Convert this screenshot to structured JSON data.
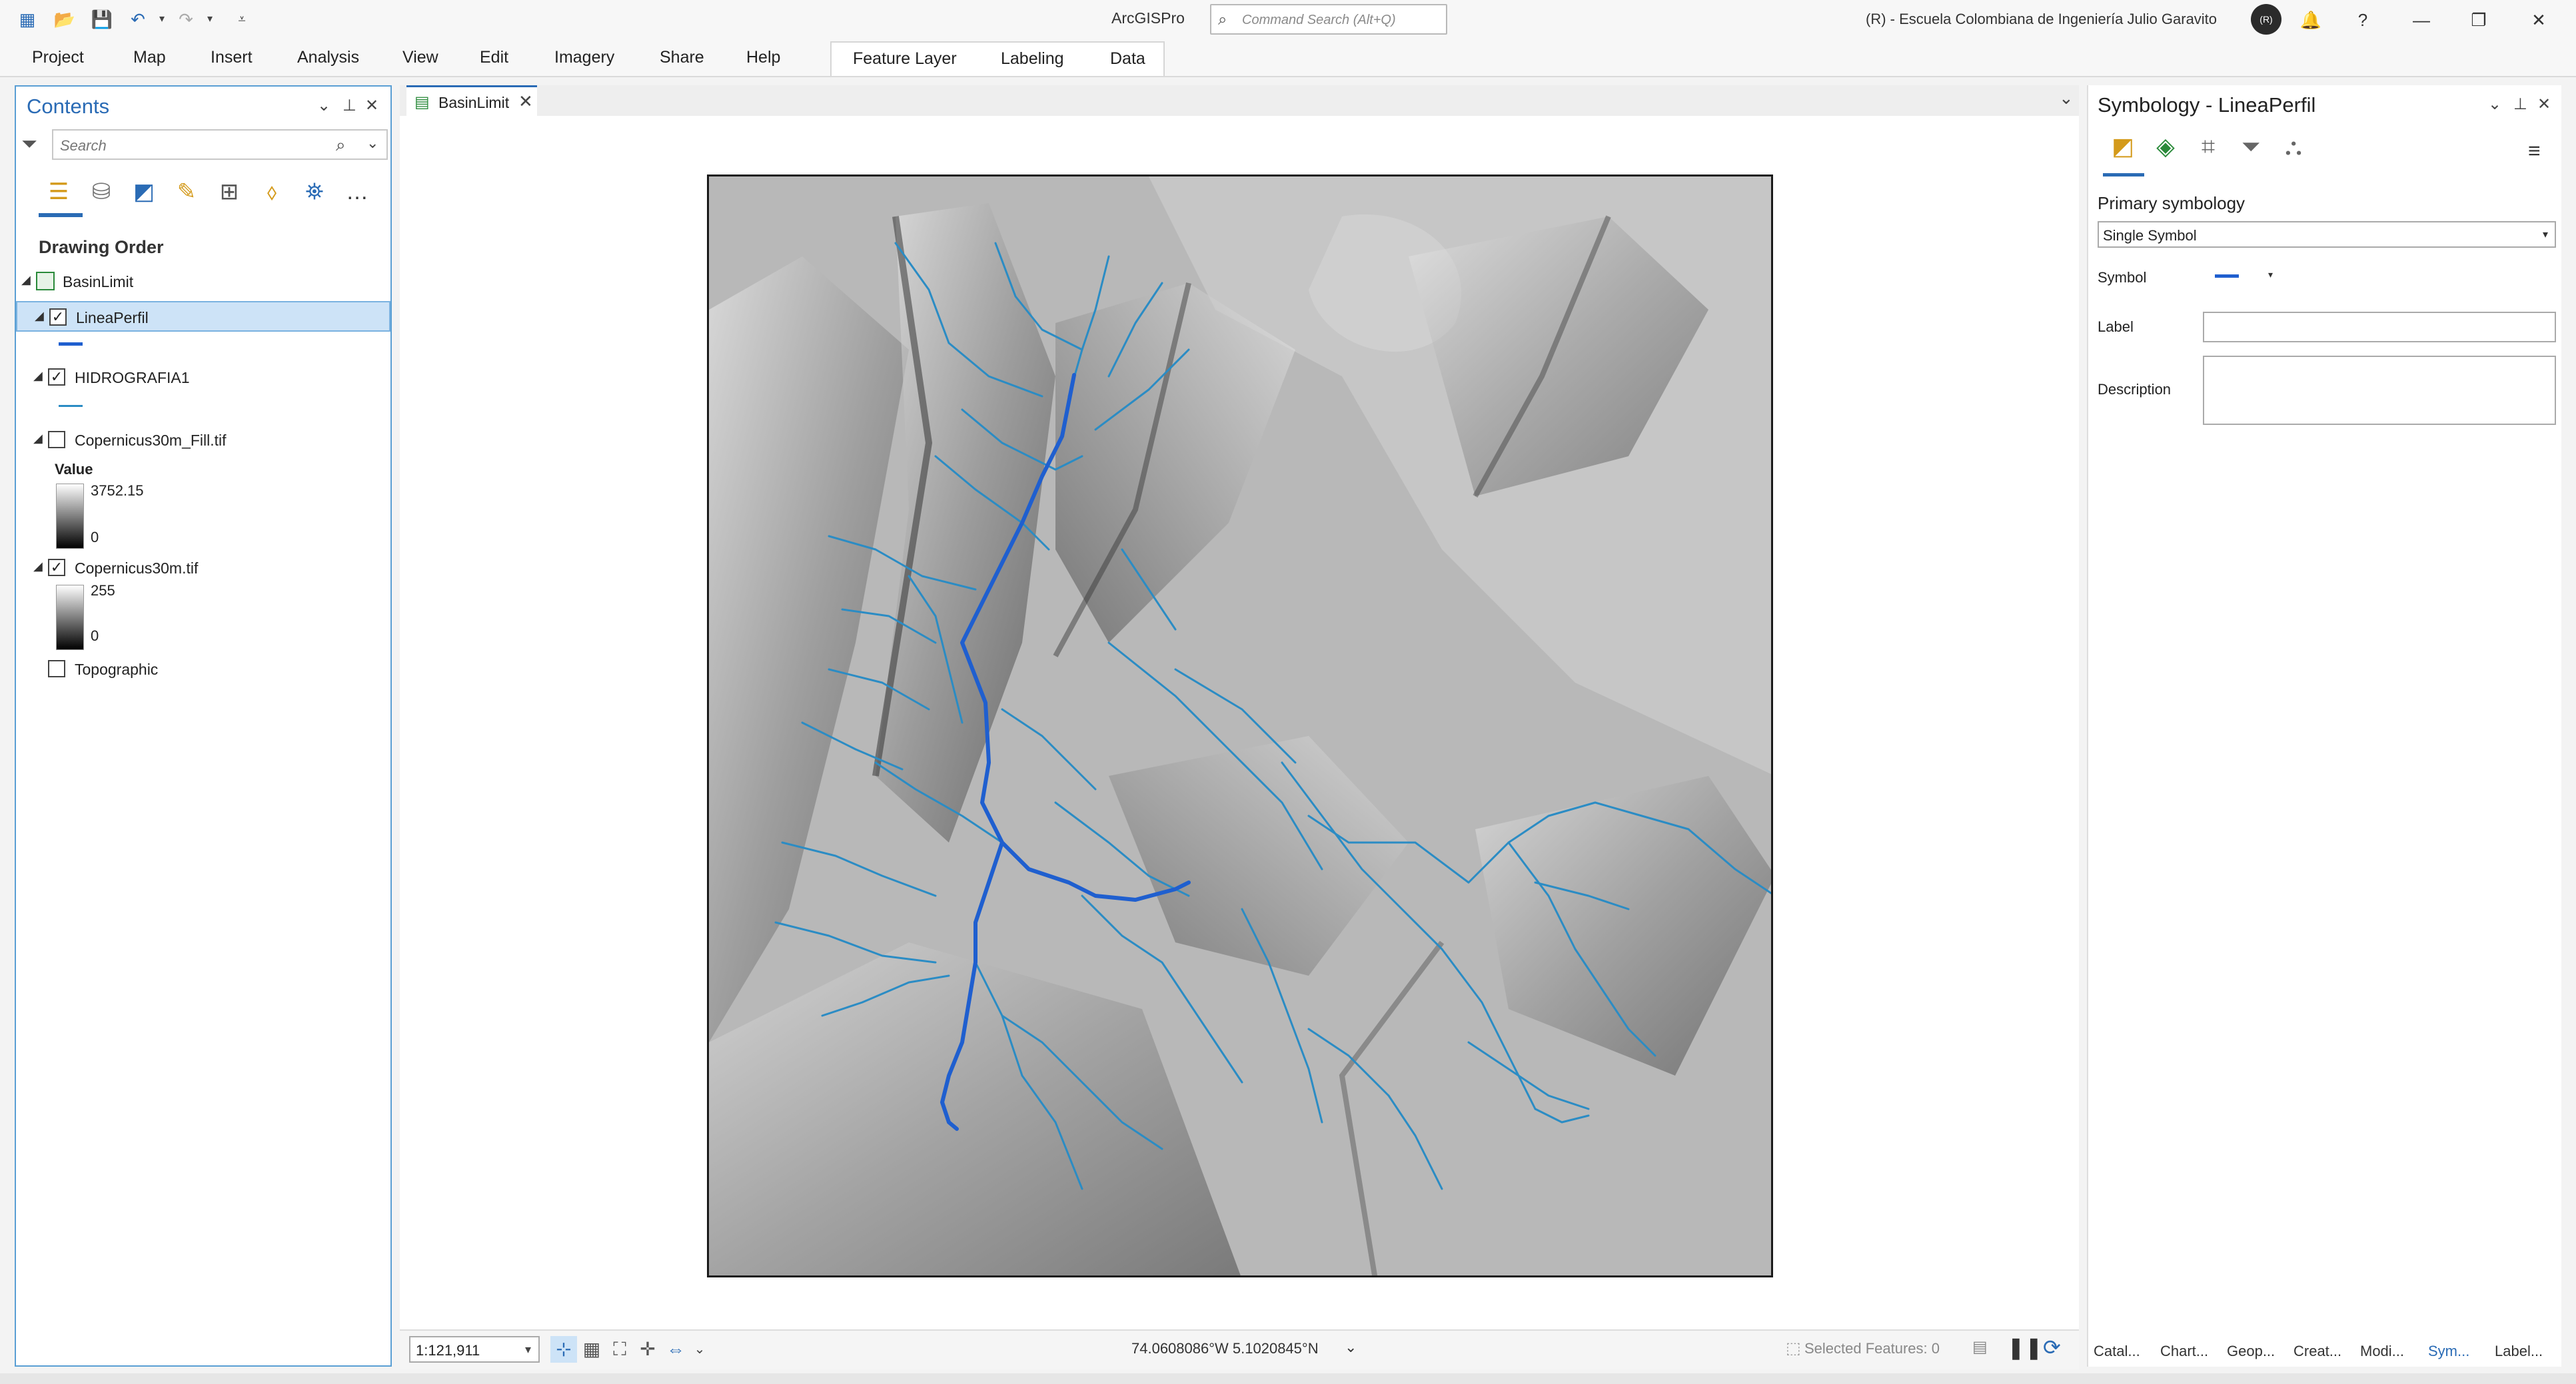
{
  "window": {
    "app_title": "ArcGISPro",
    "command_search_placeholder": "Command Search (Alt+Q)",
    "organization": "(R) - Escuela Colombiana de Ingeniería Julio Garavito",
    "avatar_initials": "(R)"
  },
  "ribbon": {
    "tabs": [
      "Project",
      "Map",
      "Insert",
      "Analysis",
      "View",
      "Edit",
      "Imagery",
      "Share",
      "Help"
    ],
    "contextual_tabs": [
      "Feature Layer",
      "Labeling",
      "Data"
    ]
  },
  "contents": {
    "title": "Contents",
    "search_placeholder": "Search",
    "section_title": "Drawing Order",
    "map_name": "BasinLimit",
    "layers": [
      {
        "name": "LineaPerfil",
        "checked": true,
        "selected": true,
        "symbol_color": "#1f5fcf"
      },
      {
        "name": "HIDROGRAFIA1",
        "checked": true,
        "selected": false,
        "symbol_color": "#2b8cc4"
      },
      {
        "name": "Copernicus30m_Fill.tif",
        "checked": false,
        "selected": false,
        "legend_title": "Value",
        "legend_max": "3752.15",
        "legend_min": "0"
      },
      {
        "name": "Copernicus30m.tif",
        "checked": true,
        "selected": false,
        "legend_max": "255",
        "legend_min": "0"
      },
      {
        "name": "Topographic",
        "checked": false,
        "selected": false
      }
    ]
  },
  "map_view": {
    "tab_label": "BasinLimit",
    "scale": "1:121,911",
    "coordinates": "74.0608086°W 5.1020845°N",
    "selected_features": "Selected Features: 0",
    "colors": {
      "profile_line": "#1f5fcf",
      "streams": "#2b8cc4"
    }
  },
  "symbology": {
    "title": "Symbology - LineaPerfil",
    "primary_label": "Primary symbology",
    "primary_value": "Single Symbol",
    "symbol_label": "Symbol",
    "label_label": "Label",
    "description_label": "Description",
    "label_value": "",
    "description_value": ""
  },
  "bottom_tabs": [
    "Catal...",
    "Chart...",
    "Geop...",
    "Creat...",
    "Modi...",
    "Sym...",
    "Label..."
  ]
}
